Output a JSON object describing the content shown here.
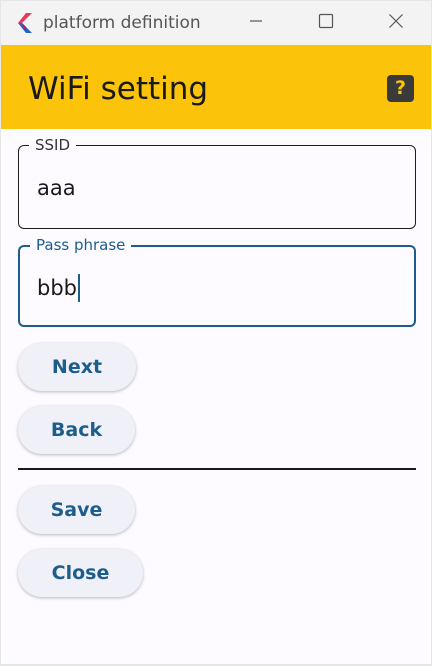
{
  "window": {
    "title": "platform definition",
    "icon": "flutter-logo-icon",
    "controls": [
      "minimize-icon",
      "maximize-icon",
      "close-icon"
    ]
  },
  "appbar": {
    "title": "WiFi setting",
    "help_icon": "help-question-icon",
    "help_glyph": "?"
  },
  "form": {
    "ssid": {
      "label": "SSID",
      "value": "aaa"
    },
    "pass_phrase": {
      "label": "Pass phrase",
      "value": "bbb"
    }
  },
  "buttons": {
    "next": "Next",
    "back": "Back",
    "save": "Save",
    "close": "Close"
  },
  "colors": {
    "appbar": "#fcc30b",
    "accent": "#1c5d8c",
    "background": "#fdfbff"
  }
}
